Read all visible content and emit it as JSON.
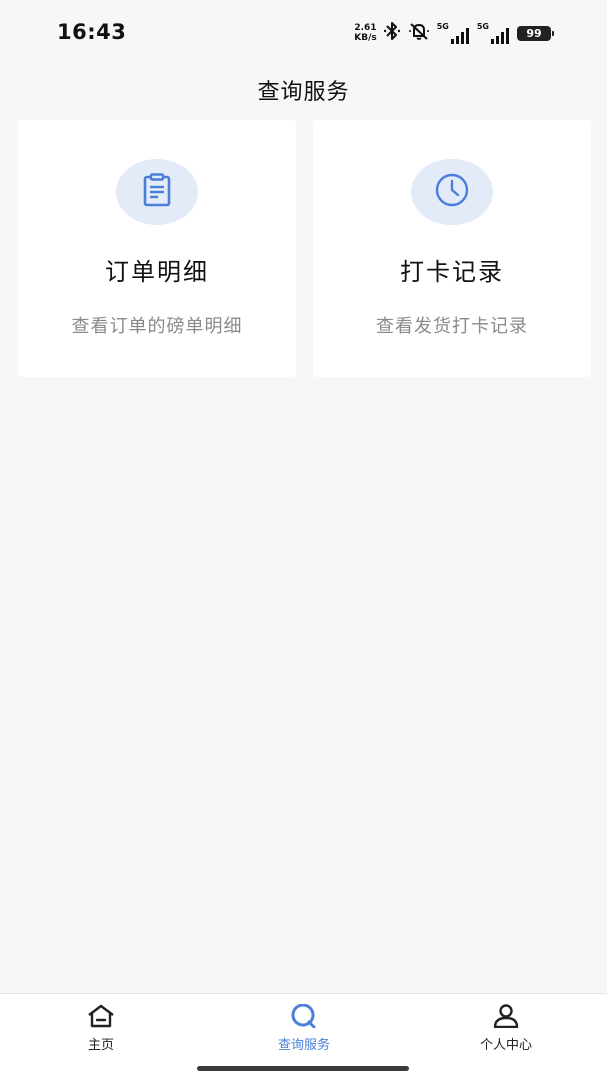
{
  "status_bar": {
    "time": "16:43",
    "net_speed_value": "2.61",
    "net_speed_unit": "KB/s",
    "sim1_label": "5G",
    "sim2_label": "5G",
    "battery": "99"
  },
  "header": {
    "title": "查询服务"
  },
  "cards": [
    {
      "title": "订单明细",
      "description": "查看订单的磅单明细",
      "icon": "clipboard-icon"
    },
    {
      "title": "打卡记录",
      "description": "查看发货打卡记录",
      "icon": "clock-icon"
    }
  ],
  "bottom_nav": {
    "items": [
      {
        "label": "主页",
        "icon": "home-icon",
        "active": false
      },
      {
        "label": "查询服务",
        "icon": "search-icon",
        "active": true
      },
      {
        "label": "个人中心",
        "icon": "user-icon",
        "active": false
      }
    ]
  },
  "colors": {
    "accent": "#4a7fd9",
    "icon_bg": "#e3ebf8",
    "background": "#f7f7f8",
    "card_bg": "#ffffff",
    "muted_text": "#8a8a8a"
  }
}
